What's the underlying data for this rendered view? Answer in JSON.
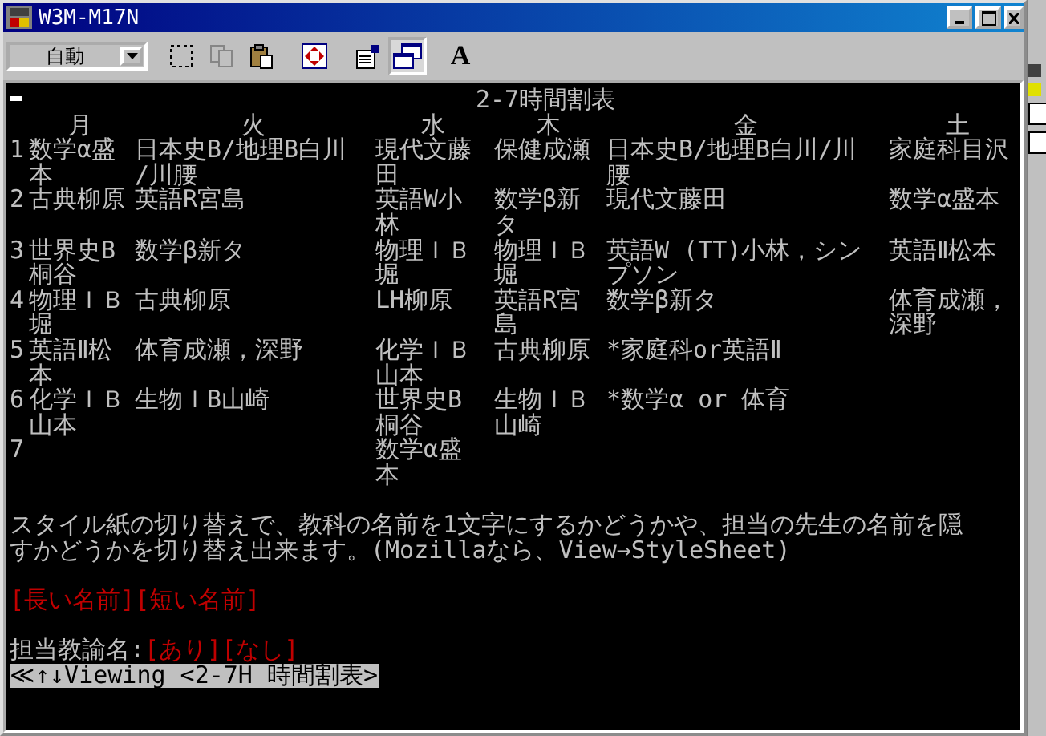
{
  "window": {
    "title": "W3M-M17N"
  },
  "toolbar": {
    "encoding": {
      "value": "自動"
    },
    "buttons": [
      {
        "kind": "select",
        "disabled": false,
        "selected": false
      },
      {
        "kind": "copy",
        "disabled": true,
        "selected": false
      },
      {
        "kind": "paste",
        "disabled": false,
        "selected": false
      },
      {
        "kind": "move",
        "disabled": false,
        "selected": false
      },
      {
        "kind": "properties",
        "disabled": false,
        "selected": false
      },
      {
        "kind": "window",
        "disabled": false,
        "selected": true
      },
      {
        "kind": "font",
        "label": "A",
        "disabled": false,
        "selected": false
      }
    ]
  },
  "page": {
    "title": "2-7時間割表",
    "days": [
      "月",
      "火",
      "水",
      "木",
      "金",
      "土"
    ],
    "rows": [
      {
        "period": "1",
        "cells": [
          [
            "数学α盛",
            "本"
          ],
          [
            "日本史B/地理B白川",
            "/川腰"
          ],
          [
            "現代文藤",
            "田"
          ],
          [
            "保健成瀬"
          ],
          [
            "日本史B/地理B白川/川",
            "腰"
          ],
          [
            "家庭科目沢"
          ]
        ]
      },
      {
        "period": "2",
        "cells": [
          [
            "古典柳原"
          ],
          [
            "英語R宮島"
          ],
          [
            "英語W小",
            "林"
          ],
          [
            "数学β新",
            "タ"
          ],
          [
            "現代文藤田"
          ],
          [
            "数学α盛本"
          ]
        ]
      },
      {
        "period": "3",
        "cells": [
          [
            "世界史B",
            "桐谷"
          ],
          [
            "数学β新タ"
          ],
          [
            "物理ＩＢ",
            "堀"
          ],
          [
            "物理ＩＢ",
            "堀"
          ],
          [
            "英語W (TT)小林，シン",
            "プソン"
          ],
          [
            "英語Ⅱ松本"
          ]
        ]
      },
      {
        "period": "4",
        "cells": [
          [
            "物理ＩＢ",
            "堀"
          ],
          [
            "古典柳原"
          ],
          [
            "LH柳原"
          ],
          [
            "英語R宮",
            "島"
          ],
          [
            "数学β新タ"
          ],
          [
            "体育成瀬，",
            "深野"
          ]
        ]
      },
      {
        "period": "5",
        "cells": [
          [
            "英語Ⅱ松",
            "本"
          ],
          [
            "体育成瀬，深野"
          ],
          [
            "化学ＩＢ",
            "山本"
          ],
          [
            "古典柳原"
          ],
          [
            "*家庭科or英語Ⅱ"
          ],
          []
        ]
      },
      {
        "period": "6",
        "cells": [
          [
            "化学ＩＢ",
            "山本"
          ],
          [
            "生物ＩB山崎"
          ],
          [
            "世界史B",
            "桐谷"
          ],
          [
            "生物ＩＢ",
            "山崎"
          ],
          [
            "*数学α or 体育"
          ],
          []
        ]
      },
      {
        "period": "7",
        "cells": [
          [],
          [],
          [
            "数学α盛",
            "本"
          ],
          [],
          [],
          []
        ]
      }
    ],
    "note_lines": [
      "スタイル紙の切り替えで、教科の名前を1文字にするかどうかや、担当の先生の名前を隠",
      "すかどうかを切り替え出来ます。(Mozillaなら、View→StyleSheet)"
    ],
    "name_links": [
      "[長い名前]",
      "[短い名前]"
    ],
    "teacher_label": "担当教諭名:",
    "teacher_links": [
      "[あり]",
      "[なし]"
    ]
  },
  "status_line": "≪↑↓Viewing <2-7H 時間割表>"
}
